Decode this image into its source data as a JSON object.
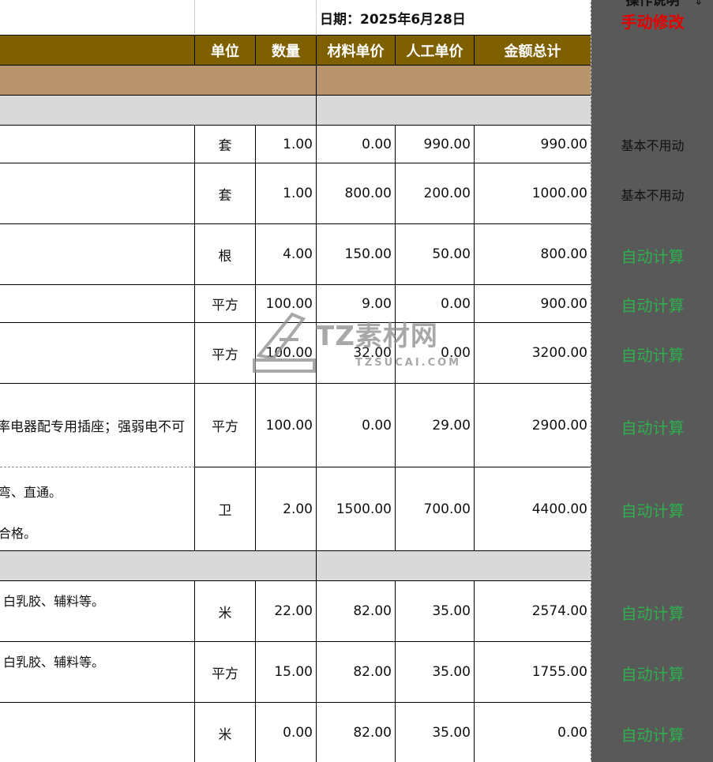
{
  "date_label": "日期：2025年6月28日",
  "headers": {
    "unit": "单位",
    "qty": "数量",
    "mat_price": "材料单价",
    "labor_price": "人工单价",
    "total": "金额总计"
  },
  "side_header": "操作说明",
  "manual_label": "手动修改",
  "rows": [
    {
      "desc": [],
      "unit": "套",
      "qty": "1.00",
      "mat": "0.00",
      "labor": "990.00",
      "total": "990.00",
      "note": "基本不用动"
    },
    {
      "desc": [],
      "unit": "套",
      "qty": "1.00",
      "mat": "800.00",
      "labor": "200.00",
      "total": "1000.00",
      "note": "基本不用动"
    },
    {
      "desc": [],
      "unit": "根",
      "qty": "4.00",
      "mat": "150.00",
      "labor": "50.00",
      "total": "800.00",
      "note": "自动计算"
    },
    {
      "desc": [],
      "unit": "平方",
      "qty": "100.00",
      "mat": "9.00",
      "labor": "0.00",
      "total": "900.00",
      "note": "自动计算"
    },
    {
      "desc": [],
      "unit": "平方",
      "qty": "100.00",
      "mat": "32.00",
      "labor": "0.00",
      "total": "3200.00",
      "note": "自动计算"
    },
    {
      "desc": [
        "率电器配专用插座；强弱电不可"
      ],
      "unit": "平方",
      "qty": "100.00",
      "mat": "0.00",
      "labor": "29.00",
      "total": "2900.00",
      "note": "自动计算"
    },
    {
      "desc": [
        "弯、直通。",
        "合格。"
      ],
      "unit": "卫",
      "qty": "2.00",
      "mat": "1500.00",
      "labor": "700.00",
      "total": "4400.00",
      "note": "自动计算"
    },
    {
      "desc": [
        "白乳胶、辅料等。"
      ],
      "unit": "米",
      "qty": "22.00",
      "mat": "82.00",
      "labor": "35.00",
      "total": "2574.00",
      "note": "自动计算"
    },
    {
      "desc": [
        "白乳胶、辅料等。"
      ],
      "unit": "平方",
      "qty": "15.00",
      "mat": "82.00",
      "labor": "35.00",
      "total": "1755.00",
      "note": "自动计算"
    },
    {
      "desc": [],
      "unit": "米",
      "qty": "0.00",
      "mat": "82.00",
      "labor": "35.00",
      "total": "0.00",
      "note": "自动计算"
    }
  ],
  "watermark": {
    "main": "TZ素材网",
    "sub": "TZSUCAI.COM"
  },
  "colors": {
    "header_bg": "#7f6000",
    "section_bg": "#b8956c",
    "subsection_bg": "#d9d9d9",
    "side_bg": "#595959",
    "auto_green": "#2db04d",
    "manual_red": "#e60000"
  }
}
